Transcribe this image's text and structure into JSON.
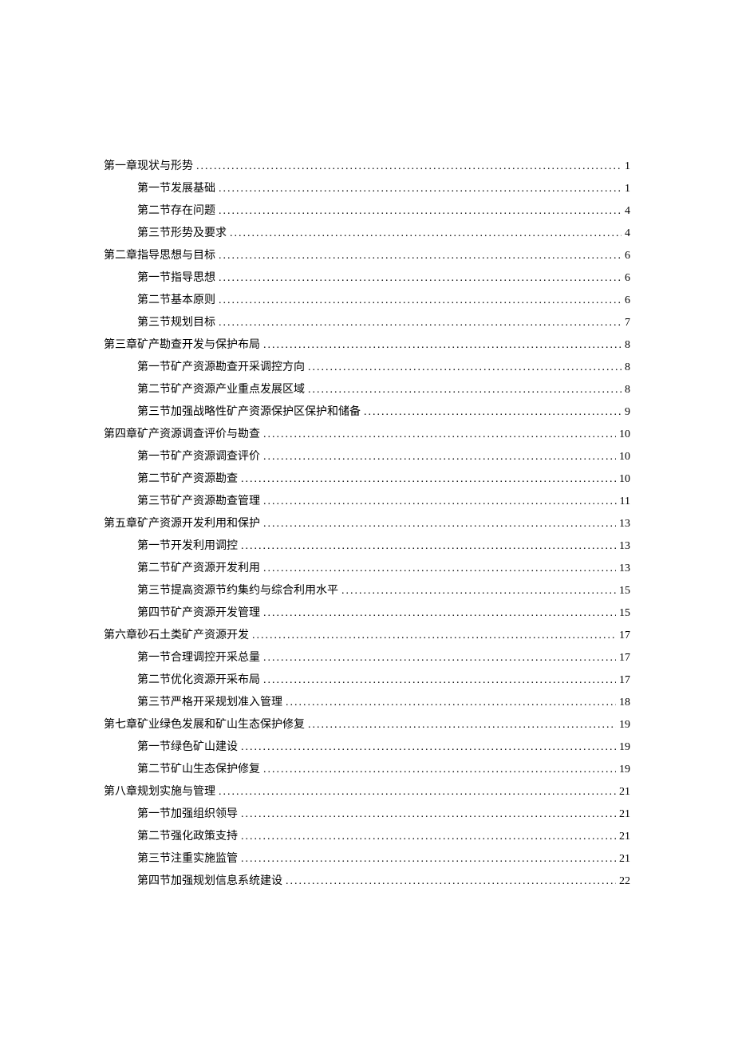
{
  "toc": [
    {
      "level": 1,
      "title": "第一章现状与形势",
      "page": "1"
    },
    {
      "level": 2,
      "title": "第一节发展基础",
      "page": "1"
    },
    {
      "level": 2,
      "title": "第二节存在问题",
      "page": "4"
    },
    {
      "level": 2,
      "title": "第三节形势及要求",
      "page": "4"
    },
    {
      "level": 1,
      "title": "第二章指导思想与目标",
      "page": "6"
    },
    {
      "level": 2,
      "title": "第一节指导思想",
      "page": "6"
    },
    {
      "level": 2,
      "title": "第二节基本原则",
      "page": "6"
    },
    {
      "level": 2,
      "title": "第三节规划目标",
      "page": "7"
    },
    {
      "level": 1,
      "title": "第三章矿产勘查开发与保护布局",
      "page": "8"
    },
    {
      "level": 2,
      "title": "第一节矿产资源勘查开采调控方向",
      "page": "8"
    },
    {
      "level": 2,
      "title": "第二节矿产资源产业重点发展区域",
      "page": "8"
    },
    {
      "level": 2,
      "title": "第三节加强战略性矿产资源保护区保护和储备",
      "page": "9"
    },
    {
      "level": 1,
      "title": "第四章矿产资源调查评价与勘查",
      "page": "10"
    },
    {
      "level": 2,
      "title": "第一节矿产资源调查评价",
      "page": "10"
    },
    {
      "level": 2,
      "title": "第二节矿产资源勘查",
      "page": "10"
    },
    {
      "level": 2,
      "title": "第三节矿产资源勘查管理",
      "page": "11"
    },
    {
      "level": 1,
      "title": "第五章矿产资源开发利用和保护",
      "page": "13"
    },
    {
      "level": 2,
      "title": "第一节开发利用调控",
      "page": "13"
    },
    {
      "level": 2,
      "title": "第二节矿产资源开发利用",
      "page": "13"
    },
    {
      "level": 2,
      "title": "第三节提高资源节约集约与综合利用水平",
      "page": "15"
    },
    {
      "level": 2,
      "title": "第四节矿产资源开发管理",
      "page": "15"
    },
    {
      "level": 1,
      "title": "第六章砂石土类矿产资源开发",
      "page": "17"
    },
    {
      "level": 2,
      "title": "第一节合理调控开采总量",
      "page": "17"
    },
    {
      "level": 2,
      "title": "第二节优化资源开采布局",
      "page": "17"
    },
    {
      "level": 2,
      "title": "第三节严格开采规划准入管理",
      "page": "18"
    },
    {
      "level": 1,
      "title": "第七章矿业绿色发展和矿山生态保护修复",
      "page": "19"
    },
    {
      "level": 2,
      "title": "第一节绿色矿山建设",
      "page": "19"
    },
    {
      "level": 2,
      "title": "第二节矿山生态保护修复",
      "page": "19"
    },
    {
      "level": 1,
      "title": "第八章规划实施与管理",
      "page": "21"
    },
    {
      "level": 2,
      "title": "第一节加强组织领导",
      "page": "21"
    },
    {
      "level": 2,
      "title": "第二节强化政策支持",
      "page": "21"
    },
    {
      "level": 2,
      "title": "第三节注重实施监管",
      "page": "21"
    },
    {
      "level": 2,
      "title": "第四节加强规划信息系统建设",
      "page": "22"
    }
  ]
}
